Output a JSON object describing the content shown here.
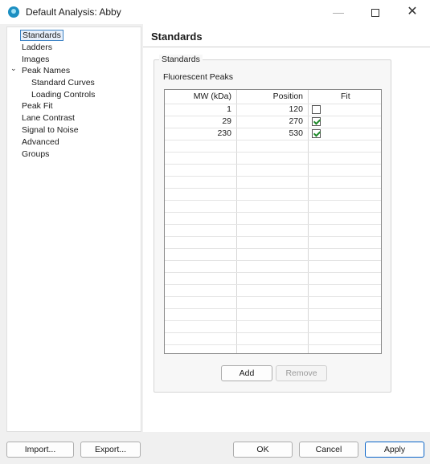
{
  "window": {
    "title": "Default Analysis: Abby",
    "minimize": "—",
    "close": "✕"
  },
  "sidebar": {
    "items": [
      {
        "label": "Standards"
      },
      {
        "label": "Ladders"
      },
      {
        "label": "Images"
      },
      {
        "label": "Peak Names"
      },
      {
        "label": "Standard Curves"
      },
      {
        "label": "Loading Controls"
      },
      {
        "label": "Peak Fit"
      },
      {
        "label": "Lane Contrast"
      },
      {
        "label": "Signal to Noise"
      },
      {
        "label": "Advanced"
      },
      {
        "label": "Groups"
      }
    ],
    "expander_glyph": "⌄",
    "selected_index": 0
  },
  "main": {
    "heading": "Standards",
    "group_label": "Standards",
    "sub_label": "Fluorescent Peaks",
    "table": {
      "columns": [
        "MW (kDa)",
        "Position",
        "Fit"
      ],
      "rows": [
        {
          "mw": "1",
          "position": "120",
          "fit": false
        },
        {
          "mw": "29",
          "position": "270",
          "fit": true
        },
        {
          "mw": "230",
          "position": "530",
          "fit": true
        }
      ]
    },
    "add_label": "Add",
    "remove_label": "Remove"
  },
  "footer": {
    "import_label": "Import...",
    "export_label": "Export...",
    "ok_label": "OK",
    "cancel_label": "Cancel",
    "apply_label": "Apply"
  },
  "colors": {
    "accent": "#0a64c8",
    "check": "#1f8a2a",
    "selection_border": "#3b82c4"
  }
}
